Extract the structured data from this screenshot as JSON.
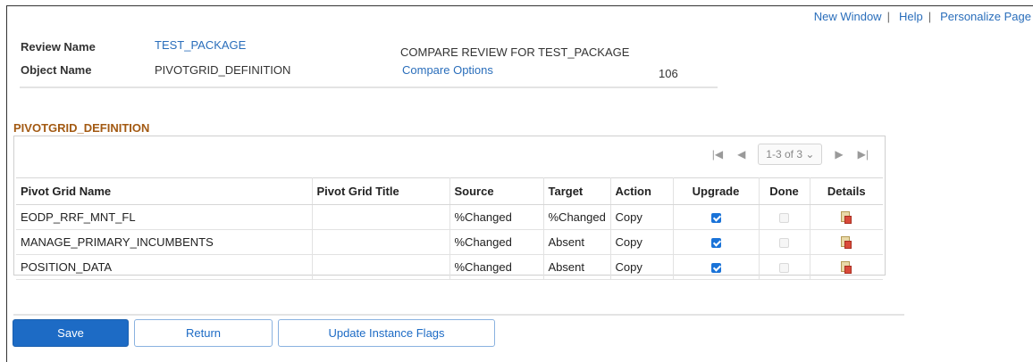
{
  "top_links": {
    "new_window": "New Window",
    "sep1": "|",
    "help": "Help",
    "sep2": "|",
    "personalize": "Personalize Page"
  },
  "header": {
    "review_name_label": "Review Name",
    "review_name_value": "TEST_PACKAGE",
    "object_name_label": "Object Name",
    "object_name_value": "PIVOTGRID_DEFINITION",
    "compare_title": "COMPARE REVIEW FOR TEST_PACKAGE",
    "compare_options": "Compare Options",
    "count": "106"
  },
  "section_title": "PIVOTGRID_DEFINITION",
  "pager": {
    "first": "|◀",
    "prev": "◀",
    "range": "1-3 of 3",
    "range_caret": "⌄",
    "next": "▶",
    "last": "▶|"
  },
  "table": {
    "columns": [
      "Pivot Grid Name",
      "Pivot Grid Title",
      "Source",
      "Target",
      "Action",
      "Upgrade",
      "Done",
      "Details"
    ],
    "rows": [
      {
        "name": "EODP_RRF_MNT_FL",
        "title": "",
        "source": "%Changed",
        "target": "%Changed",
        "action": "Copy",
        "upgrade": true,
        "done": false
      },
      {
        "name": "MANAGE_PRIMARY_INCUMBENTS",
        "title": "",
        "source": "%Changed",
        "target": "Absent",
        "action": "Copy",
        "upgrade": true,
        "done": false
      },
      {
        "name": "POSITION_DATA",
        "title": "",
        "source": "%Changed",
        "target": "Absent",
        "action": "Copy",
        "upgrade": true,
        "done": false
      }
    ]
  },
  "buttons": {
    "save": "Save",
    "return": "Return",
    "update_flags": "Update Instance Flags"
  },
  "colors": {
    "link": "#2a6ebb",
    "section_title": "#a35a13",
    "primary_button": "#1d6bc5",
    "checkbox_checked": "#1a73d8"
  },
  "icons": {
    "details": "details-page-icon",
    "pager_first": "first-page-icon",
    "pager_prev": "prev-page-icon",
    "pager_next": "next-page-icon",
    "pager_last": "last-page-icon"
  }
}
